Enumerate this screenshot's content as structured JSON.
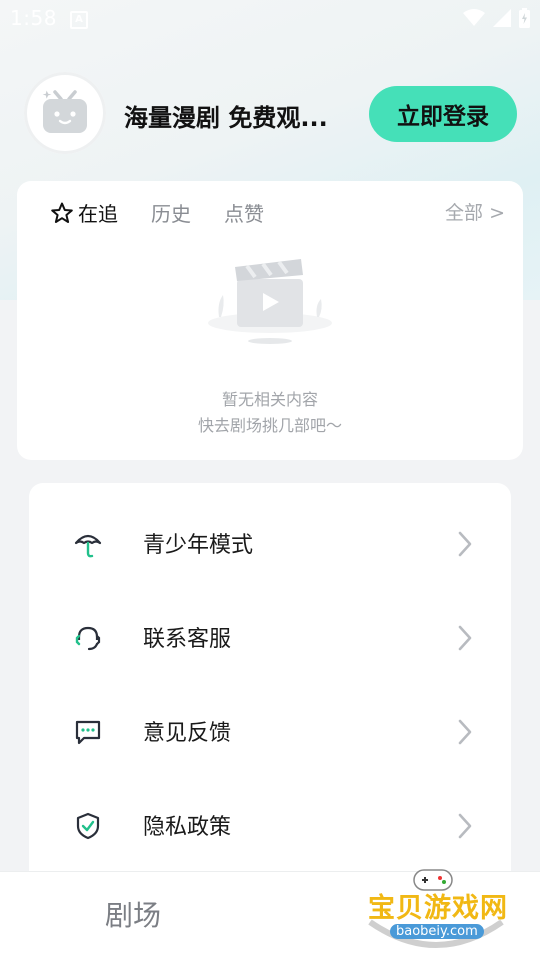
{
  "status_bar": {
    "time": "1:58",
    "notification_letter": "A"
  },
  "header": {
    "username": "海量漫剧 免费观...",
    "login_button": "立即登录"
  },
  "history": {
    "tabs": [
      {
        "label": "在追",
        "active": true
      },
      {
        "label": "历史",
        "active": false
      },
      {
        "label": "点赞",
        "active": false
      }
    ],
    "view_all": "全部 >",
    "empty_line1": "暂无相关内容",
    "empty_line2": "快去剧场挑几部吧～"
  },
  "menu": {
    "items": [
      {
        "label": "青少年模式",
        "icon": "umbrella-icon"
      },
      {
        "label": "联系客服",
        "icon": "headset-icon"
      },
      {
        "label": "意见反馈",
        "icon": "chat-bubble-icon"
      },
      {
        "label": "隐私政策",
        "icon": "shield-check-icon"
      }
    ]
  },
  "bottom_nav": {
    "theater": "剧场"
  },
  "watermark": {
    "text": "宝贝游戏网",
    "sub": "baobeiy.com"
  },
  "colors": {
    "accent": "#45e0b8",
    "icon_green": "#21c08b"
  }
}
